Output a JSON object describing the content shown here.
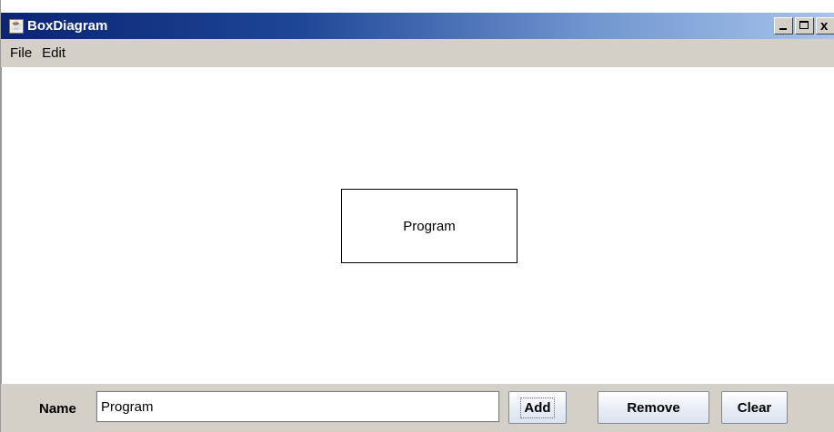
{
  "window": {
    "title": "BoxDiagram",
    "icon": "java-cup-icon"
  },
  "title_controls": {
    "minimize": "minimize-icon",
    "maximize": "maximize-icon",
    "close_glyph": "x"
  },
  "menu": {
    "items": [
      {
        "label": "File"
      },
      {
        "label": "Edit"
      }
    ]
  },
  "canvas": {
    "boxes": [
      {
        "label": "Program"
      }
    ]
  },
  "bottombar": {
    "name_label": "Name",
    "name_value": "Program",
    "buttons": {
      "add": "Add",
      "remove": "Remove",
      "clear": "Clear"
    }
  }
}
